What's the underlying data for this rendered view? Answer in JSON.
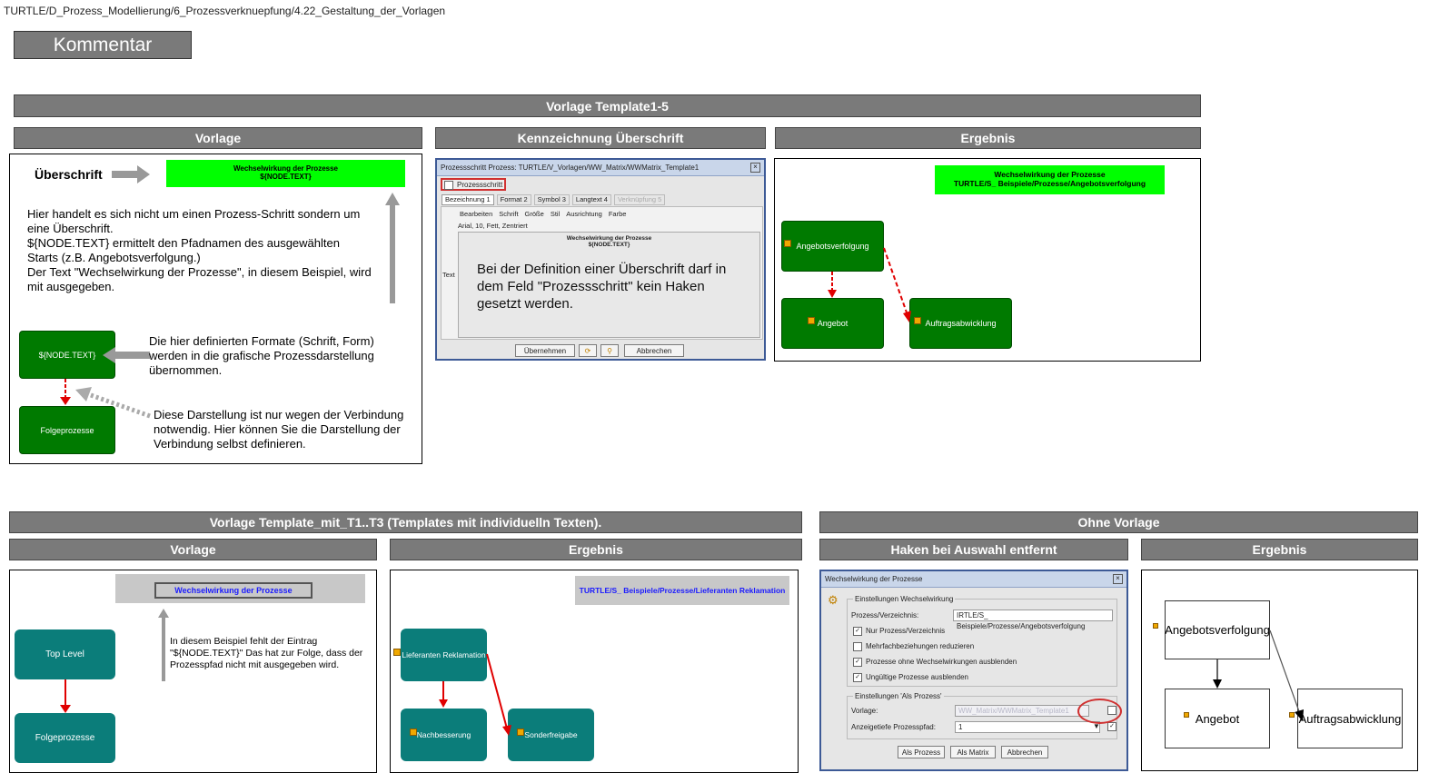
{
  "breadcrumb": "TURTLE/D_Prozess_Modellierung/6_Prozessverknuepfung/4.22_Gestaltung_der_Vorlagen",
  "kommentar": "Kommentar",
  "section1": {
    "title": "Vorlage Template1-5",
    "col_vorlage": "Vorlage",
    "col_kennzeichnung": "Kennzeichnung Überschrift",
    "col_ergebnis": "Ergebnis",
    "vorlage": {
      "ueberschrift_label": "Überschrift",
      "header_line1": "Wechselwirkung der Prozesse",
      "header_line2": "${NODE.TEXT}",
      "para1": "Hier handelt es sich nicht um einen Prozess-Schritt sondern um eine Überschrift.",
      "para2": "${NODE.TEXT} ermittelt den Pfadnamen des ausgewählten Starts (z.B. Angebotsverfolgung.)",
      "para3": "Der Text \"Wechselwirkung der Prozesse\", in diesem Beispiel, wird mit ausgegeben.",
      "node_text_box": "${NODE.TEXT}",
      "folge_box": "Folgeprozesse",
      "formats_text": "Die hier definierten Formate (Schrift, Form) werden in die grafische Prozessdarstellung übernommen.",
      "darstellung_text": "Diese Darstellung ist nur wegen der Verbindung notwendig. Hier können Sie die Darstellung der Verbindung selbst definieren."
    },
    "dialog": {
      "title": "Prozessschritt Prozess: TURTLE/V_Vorlagen/WW_Matrix/WWMatrix_Template1",
      "checkbox": "Prozessschritt",
      "tabs": [
        "Bezeichnung 1",
        "Format 2",
        "Symbol 3",
        "Langtext 4",
        "Verknüpfung 5"
      ],
      "menu": [
        "Bearbeiten",
        "Schrift",
        "Größe",
        "Stil",
        "Ausrichtung",
        "Farbe"
      ],
      "font_info": "Arial, 10, Fett, Zentriert",
      "text_label": "Text",
      "text_line1": "Wechselwirkung der Prozesse",
      "text_line2": "${NODE.TEXT}",
      "note": "Bei der Definition einer Überschrift darf in dem Feld \"Prozessschritt\" kein Haken gesetzt werden.",
      "btn_ok": "Übernehmen",
      "btn_cancel": "Abbrechen"
    },
    "ergebnis": {
      "header_line1": "Wechselwirkung der Prozesse",
      "header_line2": "TURTLE/S_ Beispiele/Prozesse/Angebotsverfolgung",
      "box1": "Angebotsverfolgung",
      "box2": "Angebot",
      "box3": "Auftragsabwicklung"
    }
  },
  "section2": {
    "title": "Vorlage Template_mit_T1..T3 (Templates mit individuelln Texten).",
    "col_vorlage": "Vorlage",
    "col_ergebnis": "Ergebnis",
    "vorlage": {
      "header": "Wechselwirkung der Prozesse",
      "box1": "Top Level",
      "box2": "Folgeprozesse",
      "text": "In diesem Beispiel fehlt der Eintrag \"${NODE.TEXT}\" Das hat zur Folge, dass der Prozesspfad nicht mit ausgegeben wird."
    },
    "ergebnis": {
      "header": "TURTLE/S_ Beispiele/Prozesse/Lieferanten Reklamation",
      "box1": "Lieferanten Reklamation",
      "box2": "Nachbesserung",
      "box3": "Sonderfreigabe"
    }
  },
  "section3": {
    "title": "Ohne Vorlage",
    "col_haken": "Haken bei Auswahl entfernt",
    "col_ergebnis": "Ergebnis",
    "dialog": {
      "title": "Wechselwirkung der Prozesse",
      "group1": "Einstellungen Wechselwirkung",
      "path_label": "Prozess/Verzeichnis:",
      "path_value": "IRTLE/S_ Beispiele/Prozesse/Angebotsverfolgung",
      "opt1": "Nur Prozess/Verzeichnis",
      "opt2": "Mehrfachbeziehungen reduzieren",
      "opt3": "Prozesse ohne Wechselwirkungen ausblenden",
      "opt4": "Ungültige Prozesse ausblenden",
      "group2": "Einstellungen 'Als Prozess'",
      "vorlage_label": "Vorlage:",
      "vorlage_value": "WW_Matrix/WWMatrix_Template1",
      "tiefe_label": "Anzeigetiefe Prozesspfad:",
      "tiefe_value": "1",
      "btn1": "Als Prozess",
      "btn2": "Als Matrix",
      "btn3": "Abbrechen"
    },
    "ergebnis": {
      "box1": "Angebotsverfolgung",
      "box2": "Angebot",
      "box3": "Auftragsabwicklung"
    }
  },
  "colors": {
    "bar": "#7a7a7a",
    "green_header": "#00ff00",
    "green_box": "#007a00",
    "teal_box": "#0b7d7a",
    "arrow_red": "#e00000",
    "highlight_red": "#d03030"
  }
}
